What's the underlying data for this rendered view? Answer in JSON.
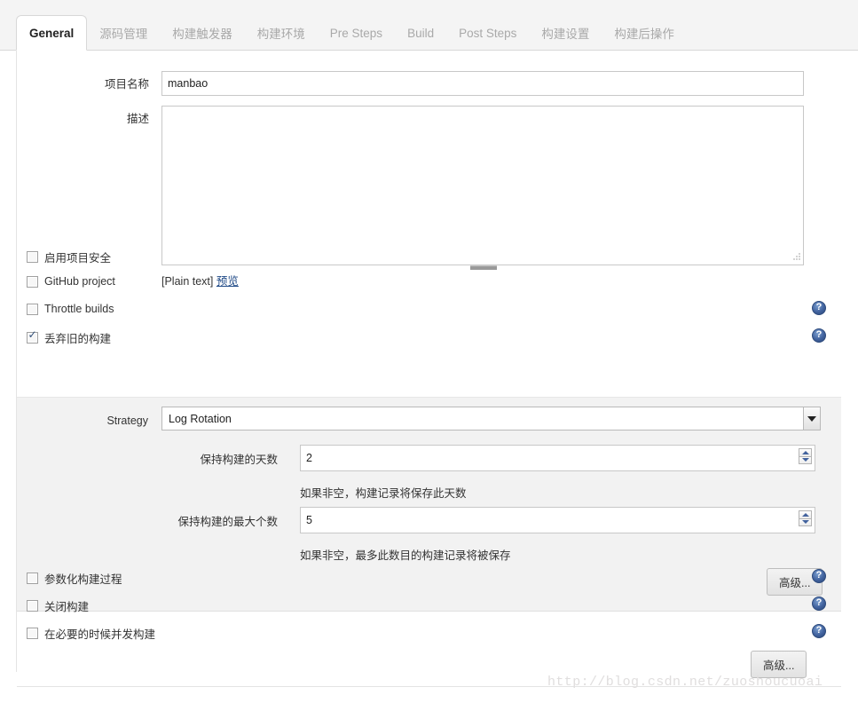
{
  "tabs": [
    {
      "label": "General",
      "active": true
    },
    {
      "label": "源码管理",
      "active": false
    },
    {
      "label": "构建触发器",
      "active": false
    },
    {
      "label": "构建环境",
      "active": false
    },
    {
      "label": "Pre Steps",
      "active": false
    },
    {
      "label": "Build",
      "active": false
    },
    {
      "label": "Post Steps",
      "active": false
    },
    {
      "label": "构建设置",
      "active": false
    },
    {
      "label": "构建后操作",
      "active": false
    }
  ],
  "form": {
    "project_name_label": "项目名称",
    "project_name_value": "manbao",
    "description_label": "描述",
    "description_value": "",
    "markup_format": "[Plain text]",
    "preview_link": "预览"
  },
  "checkboxes_top": [
    {
      "label": "启用项目安全",
      "checked": false,
      "help": false
    },
    {
      "label": "GitHub project",
      "checked": false,
      "help": false
    },
    {
      "label": "Throttle builds",
      "checked": false,
      "help": true
    },
    {
      "label": "丢弃旧的构建",
      "checked": true,
      "help": true
    }
  ],
  "log_rotation": {
    "strategy_label": "Strategy",
    "strategy_value": "Log Rotation",
    "days_label": "保持构建的天数",
    "days_value": "2",
    "days_hint": "如果非空，构建记录将保存此天数",
    "max_label": "保持构建的最大个数",
    "max_value": "5",
    "max_hint": "如果非空，最多此数目的构建记录将被保存",
    "advanced_button": "高级..."
  },
  "checkboxes_bottom": [
    {
      "label": "参数化构建过程",
      "checked": false,
      "help": true
    },
    {
      "label": "关闭构建",
      "checked": false,
      "help": true
    },
    {
      "label": "在必要的时候并发构建",
      "checked": false,
      "help": true
    }
  ],
  "footer": {
    "advanced_button": "高级...",
    "watermark": "http://blog.csdn.net/zuoshoucuoai"
  },
  "icons": {
    "help": "help-icon",
    "caret": "chevron-down-icon",
    "spinner_up": "spinner-up-icon",
    "spinner_down": "spinner-down-icon",
    "resize": "resize-grip-icon"
  }
}
